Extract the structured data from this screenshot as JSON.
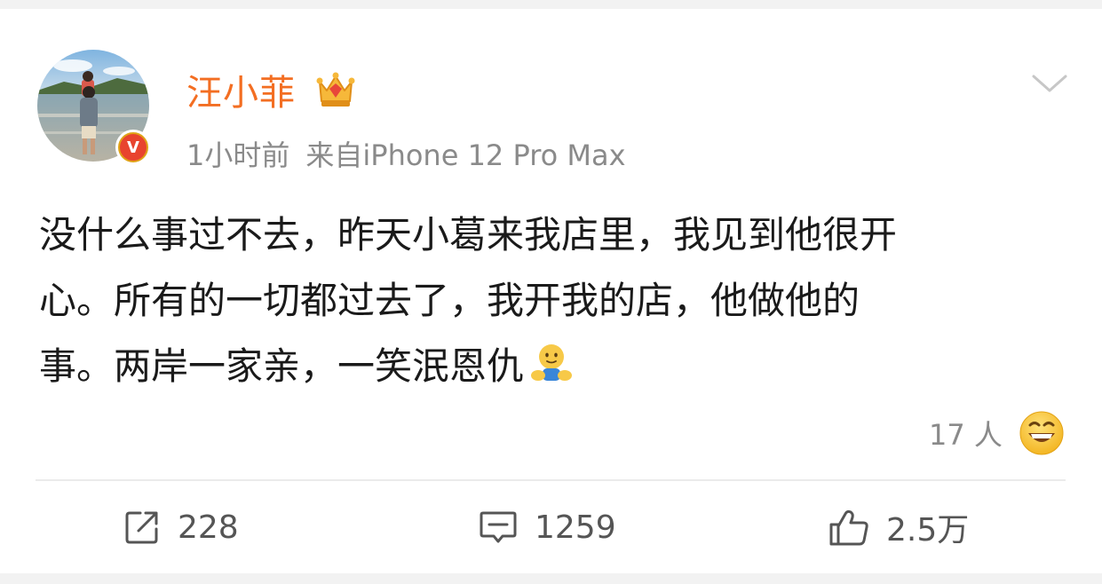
{
  "post": {
    "username": "汪小菲",
    "time": "1小时前",
    "source": "来自iPhone 12 Pro Max",
    "content_lines": [
      "没什么事过不去，昨天小葛来我店里，我见到他很开",
      "心。所有的一切都过去了，我开我的店，他做他的",
      "事。两岸一家亲，一笑泯恩仇"
    ],
    "verified_badge": "V",
    "reaction_count": "17 人"
  },
  "actions": {
    "repost": "228",
    "comment": "1259",
    "like": "2.5万"
  },
  "icons": {
    "verified": "verified-badge-icon",
    "crown": "crown-vip-icon",
    "expand": "chevron-down-icon",
    "hug_emoji": "hug-emoji-icon",
    "laugh_emoji": "laugh-emoji-icon",
    "repost": "repost-icon",
    "comment": "comment-icon",
    "like": "thumbs-up-icon"
  },
  "colors": {
    "username": "#f36e22",
    "meta": "#8a8a8a",
    "text": "#1a1a1a",
    "action_text": "#555555"
  }
}
